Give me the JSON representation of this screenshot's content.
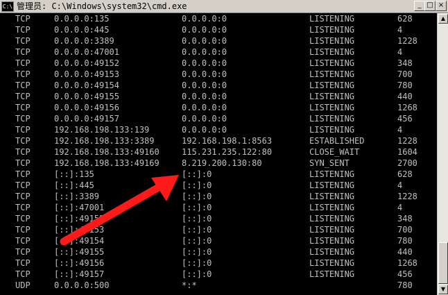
{
  "window": {
    "app_icon_text": "C:\\",
    "title": "管理员: C:\\Windows\\system32\\cmd.exe",
    "min_symbol": "_",
    "max_symbol": "□",
    "close_symbol": "×"
  },
  "scrollbar": {
    "up_symbol": "▲",
    "down_symbol": "▼"
  },
  "annotation": {
    "arrow_color": "#ff1a1a"
  },
  "rows": [
    {
      "proto": "TCP",
      "local": "0.0.0.0:135",
      "foreign": "0.0.0.0:0",
      "state": "LISTENING",
      "pid": "628"
    },
    {
      "proto": "TCP",
      "local": "0.0.0.0:445",
      "foreign": "0.0.0.0:0",
      "state": "LISTENING",
      "pid": "4"
    },
    {
      "proto": "TCP",
      "local": "0.0.0.0:3389",
      "foreign": "0.0.0.0:0",
      "state": "LISTENING",
      "pid": "1228"
    },
    {
      "proto": "TCP",
      "local": "0.0.0.0:47001",
      "foreign": "0.0.0.0:0",
      "state": "LISTENING",
      "pid": "4"
    },
    {
      "proto": "TCP",
      "local": "0.0.0.0:49152",
      "foreign": "0.0.0.0:0",
      "state": "LISTENING",
      "pid": "348"
    },
    {
      "proto": "TCP",
      "local": "0.0.0.0:49153",
      "foreign": "0.0.0.0:0",
      "state": "LISTENING",
      "pid": "700"
    },
    {
      "proto": "TCP",
      "local": "0.0.0.0:49154",
      "foreign": "0.0.0.0:0",
      "state": "LISTENING",
      "pid": "780"
    },
    {
      "proto": "TCP",
      "local": "0.0.0.0:49155",
      "foreign": "0.0.0.0:0",
      "state": "LISTENING",
      "pid": "440"
    },
    {
      "proto": "TCP",
      "local": "0.0.0.0:49156",
      "foreign": "0.0.0.0:0",
      "state": "LISTENING",
      "pid": "1268"
    },
    {
      "proto": "TCP",
      "local": "0.0.0.0:49157",
      "foreign": "0.0.0.0:0",
      "state": "LISTENING",
      "pid": "456"
    },
    {
      "proto": "TCP",
      "local": "192.168.198.133:139",
      "foreign": "0.0.0.0:0",
      "state": "LISTENING",
      "pid": "4"
    },
    {
      "proto": "TCP",
      "local": "192.168.198.133:3389",
      "foreign": "192.168.198.1:8563",
      "state": "ESTABLISHED",
      "pid": "1228"
    },
    {
      "proto": "TCP",
      "local": "192.168.198.133:49160",
      "foreign": "115.231.235.122:80",
      "state": "CLOSE_WAIT",
      "pid": "1604"
    },
    {
      "proto": "TCP",
      "local": "192.168.198.133:49169",
      "foreign": "8.219.200.130:80",
      "state": "SYN_SENT",
      "pid": "2700"
    },
    {
      "proto": "TCP",
      "local": "[::]:135",
      "foreign": "[::]:0",
      "state": "LISTENING",
      "pid": "628"
    },
    {
      "proto": "TCP",
      "local": "[::]:445",
      "foreign": "[::]:0",
      "state": "LISTENING",
      "pid": "4"
    },
    {
      "proto": "TCP",
      "local": "[::]:3389",
      "foreign": "[::]:0",
      "state": "LISTENING",
      "pid": "1228"
    },
    {
      "proto": "TCP",
      "local": "[::]:47001",
      "foreign": "[::]:0",
      "state": "LISTENING",
      "pid": "4"
    },
    {
      "proto": "TCP",
      "local": "[::]:49152",
      "foreign": "[::]:0",
      "state": "LISTENING",
      "pid": "348"
    },
    {
      "proto": "TCP",
      "local": "[::]:49153",
      "foreign": "[::]:0",
      "state": "LISTENING",
      "pid": "700"
    },
    {
      "proto": "TCP",
      "local": "[::]:49154",
      "foreign": "[::]:0",
      "state": "LISTENING",
      "pid": "780"
    },
    {
      "proto": "TCP",
      "local": "[::]:49155",
      "foreign": "[::]:0",
      "state": "LISTENING",
      "pid": "440"
    },
    {
      "proto": "TCP",
      "local": "[::]:49156",
      "foreign": "[::]:0",
      "state": "LISTENING",
      "pid": "1268"
    },
    {
      "proto": "TCP",
      "local": "[::]:49157",
      "foreign": "[::]:0",
      "state": "LISTENING",
      "pid": "456"
    },
    {
      "proto": "UDP",
      "local": "0.0.0.0:500",
      "foreign": "*:*",
      "state": "",
      "pid": "780"
    }
  ]
}
